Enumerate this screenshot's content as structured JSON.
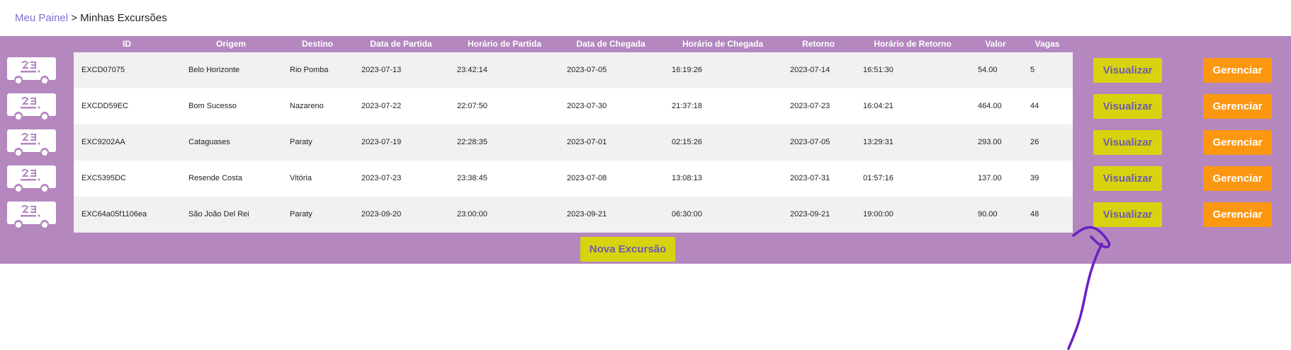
{
  "breadcrumb": {
    "home": "Meu Painel",
    "separator": ">",
    "current": "Minhas Excursões"
  },
  "table": {
    "headers": {
      "id": "ID",
      "origem": "Origem",
      "destino": "Destino",
      "data_partida": "Data de Partida",
      "horario_partida": "Horário de Partida",
      "data_chegada": "Data de Chegada",
      "horario_chegada": "Horário de Chegada",
      "retorno": "Retorno",
      "horario_retorno": "Horário de Retorno",
      "valor": "Valor",
      "vagas": "Vagas"
    },
    "rows": [
      {
        "id": "EXCD07075",
        "origem": "Belo Horizonte",
        "destino": "Rio Pomba",
        "data_partida": "2023-07-13",
        "horario_partida": "23:42:14",
        "data_chegada": "2023-07-05",
        "horario_chegada": "16:19:26",
        "retorno": "2023-07-14",
        "horario_retorno": "16:51:30",
        "valor": "54.00",
        "vagas": "5"
      },
      {
        "id": "EXCDD59EC",
        "origem": "Bom Sucesso",
        "destino": "Nazareno",
        "data_partida": "2023-07-22",
        "horario_partida": "22:07:50",
        "data_chegada": "2023-07-30",
        "horario_chegada": "21:37:18",
        "retorno": "2023-07-23",
        "horario_retorno": "16:04:21",
        "valor": "464.00",
        "vagas": "44"
      },
      {
        "id": "EXC9202AA",
        "origem": "Cataguases",
        "destino": "Paraty",
        "data_partida": "2023-07-19",
        "horario_partida": "22:28:35",
        "data_chegada": "2023-07-01",
        "horario_chegada": "02:15:26",
        "retorno": "2023-07-05",
        "horario_retorno": "13:29:31",
        "valor": "293.00",
        "vagas": "26"
      },
      {
        "id": "EXC5395DC",
        "origem": "Resende Costa",
        "destino": "Vitória",
        "data_partida": "2023-07-23",
        "horario_partida": "23:38:45",
        "data_chegada": "2023-07-08",
        "horario_chegada": "13:08:13",
        "retorno": "2023-07-31",
        "horario_retorno": "01:57:16",
        "valor": "137.00",
        "vagas": "39"
      },
      {
        "id": "EXC64a05f1106ea",
        "origem": "São João Del Rei",
        "destino": "Paraty",
        "data_partida": "2023-09-20",
        "horario_partida": "23:00:00",
        "data_chegada": "2023-09-21",
        "horario_chegada": "06:30:00",
        "retorno": "2023-09-21",
        "horario_retorno": "19:00:00",
        "valor": "90.00",
        "vagas": "48"
      }
    ]
  },
  "actions": {
    "view_label": "Visualizar",
    "manage_label": "Gerenciar",
    "new_label": "Nova Excursão"
  },
  "colors": {
    "band": "#b487bf",
    "view_button": "#d8d30f",
    "manage_button": "#fb9711",
    "arrow_annotation": "#6a1fc4",
    "link": "#7b6fd0"
  },
  "icons": {
    "row_icon": "bus-logo-icon",
    "annotation": "hand-drawn-arrow"
  }
}
